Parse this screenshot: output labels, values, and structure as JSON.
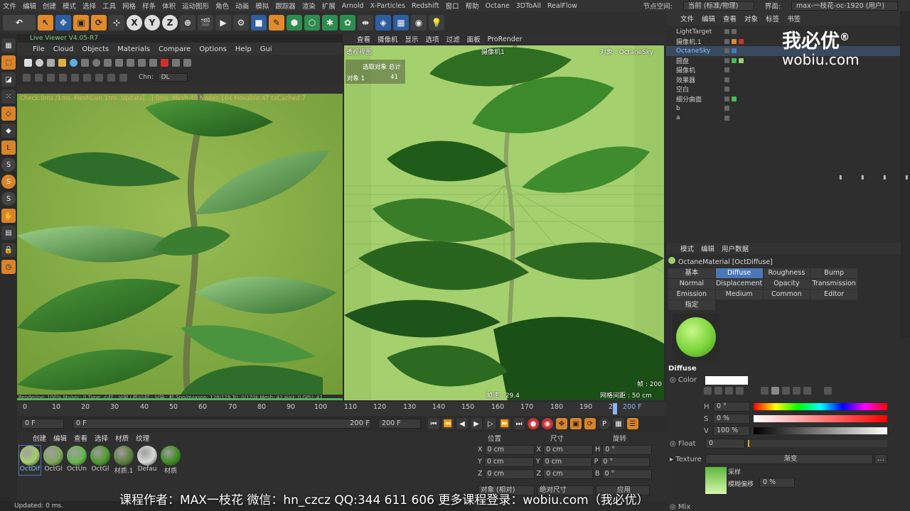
{
  "menubar": {
    "items": [
      "文件",
      "编辑",
      "创建",
      "模式",
      "选择",
      "工具",
      "网格",
      "样条",
      "体积",
      "运动图形",
      "角色",
      "动画",
      "模拟",
      "跟踪器",
      "渲染",
      "扩展",
      "Arnold",
      "X-Particles",
      "Redshift",
      "窗口",
      "帮助",
      "Octane",
      "3DToAll",
      "RealFlow"
    ],
    "node_space_label": "节点空间:",
    "node_space_value": "当前 (标准/物理)",
    "interface_label": "界面:",
    "interface_value": "max-一枝花-oc-1920 (用户)"
  },
  "toolbar": {
    "axis_labels": [
      "X",
      "Y",
      "Z"
    ]
  },
  "live_viewer": {
    "title": "Live Viewer V4.05-R7",
    "menu": [
      "File",
      "Cloud",
      "Objects",
      "Materials",
      "Compare",
      "Options",
      "Help",
      "Gui"
    ],
    "channel_label": "Chn:",
    "channel_value": "DL",
    "status_line": "Check:0ms./1ms. MeshGen:1ms. Update[...]:0ms. Mesh:40 Nodes:104 Movable:47 txCached:7",
    "stats_line": "Rendering: 100%   Ms/sec: 0   Time: 小时 : 分钟 / 秒/小时 : 分钟 : 秒   Spp/maxspp: 128/128   Tri: 0/170k   Mesh: 42   Hair: 0   GPU: 47"
  },
  "viewport": {
    "menu": [
      "查看",
      "摄像机",
      "显示",
      "选项",
      "过滤",
      "面板",
      "ProRender"
    ],
    "view_name": "透视视图",
    "camera_label": "摄像机1",
    "object_label": "对象 : OctaneSky",
    "selected_header": "选取对象  总计",
    "object_count_label": "对象  1",
    "object_count_value": "41",
    "speed": "帧速 : 29.4",
    "grid_spacing": "网格间距 : 50 cm",
    "frame_label": "帧 : 200"
  },
  "object_manager": {
    "menu": [
      "文件",
      "编辑",
      "查看",
      "对象",
      "标签",
      "书签"
    ],
    "objects": [
      "LightTarget",
      "摄像机.1",
      "OctaneSky",
      "圆盘",
      "摄像机",
      "效果器",
      "空白",
      "细分曲面",
      "b",
      "a"
    ]
  },
  "logo": {
    "text": "我必优",
    "mark": "®",
    "url": "wobiu.com"
  },
  "attributes": {
    "menu": [
      "模式",
      "编辑",
      "用户数据"
    ],
    "material_title": "OctaneMaterial [OctDiffuse]",
    "tabs": [
      "基本",
      "Diffuse",
      "Roughness",
      "Bump",
      "Normal",
      "Displacement",
      "Opacity",
      "Transmission",
      "Emission",
      "Medium",
      "Common",
      "Editor",
      "指定"
    ],
    "active_tab": "Diffuse",
    "section": "Diffuse",
    "color_label": "Color",
    "h_label": "H",
    "h_value": "0 °",
    "s_label": "S",
    "s_value": "0 %",
    "v_label": "V",
    "v_value": "100 %",
    "float_label": "Float",
    "float_value": "0",
    "texture_label": "Texture",
    "texture_value": "渐变",
    "sample_label": "采样",
    "blur_offset_label": "模糊偏移",
    "blur_offset_value": "0 %",
    "mix_label": "Mix"
  },
  "timeline": {
    "ticks": [
      "0",
      "10",
      "20",
      "30",
      "40",
      "50",
      "60",
      "70",
      "80",
      "90",
      "100",
      "110",
      "120",
      "130",
      "140",
      "150",
      "160",
      "170",
      "180",
      "190",
      "2"
    ],
    "current_frame": "200 F",
    "start": "0 F",
    "min": "0 F",
    "max": "200 F",
    "end": "200 F"
  },
  "material_manager": {
    "menu": [
      "创建",
      "编辑",
      "查看",
      "选择",
      "材质",
      "纹理"
    ],
    "materials": [
      {
        "name": "OctDif",
        "color": "#a7cf6c"
      },
      {
        "name": "OctGl",
        "color": "#7fa85a"
      },
      {
        "name": "OctUn",
        "color": "#62b84a"
      },
      {
        "name": "OctGl",
        "color": "#4e9a2f"
      },
      {
        "name": "材质.1",
        "color": "#5d7d3c"
      },
      {
        "name": "Defau",
        "color": "#d8d8d8"
      },
      {
        "name": "材质",
        "color": "#3e8e1f"
      }
    ]
  },
  "coordinates": {
    "headers": [
      "位置",
      "尺寸",
      "旋转"
    ],
    "rows": [
      {
        "axis": "X",
        "pos": "0 cm",
        "size_axis": "X",
        "size": "0 cm",
        "rot_axis": "H",
        "rot": "0 °"
      },
      {
        "axis": "Y",
        "pos": "0 cm",
        "size_axis": "Y",
        "size": "0 cm",
        "rot_axis": "P",
        "rot": "0 °"
      },
      {
        "axis": "Z",
        "pos": "0 cm",
        "size_axis": "Z",
        "size": "0 cm",
        "rot_axis": "B",
        "rot": "0 °"
      }
    ],
    "mode": "对象 (相对)",
    "size_mode": "绝对尺寸",
    "apply": "应用"
  },
  "subtitle": "课程作者：MAX一枝花    微信：hn_czcz    QQ:344 611 606    更多课程登录：wobiu.com（我必优）",
  "statusbar": "Updated: 0 ms.",
  "colors": {
    "accent": "#4a78b7",
    "green": "#3ec24a",
    "orange": "#e08a2c"
  }
}
